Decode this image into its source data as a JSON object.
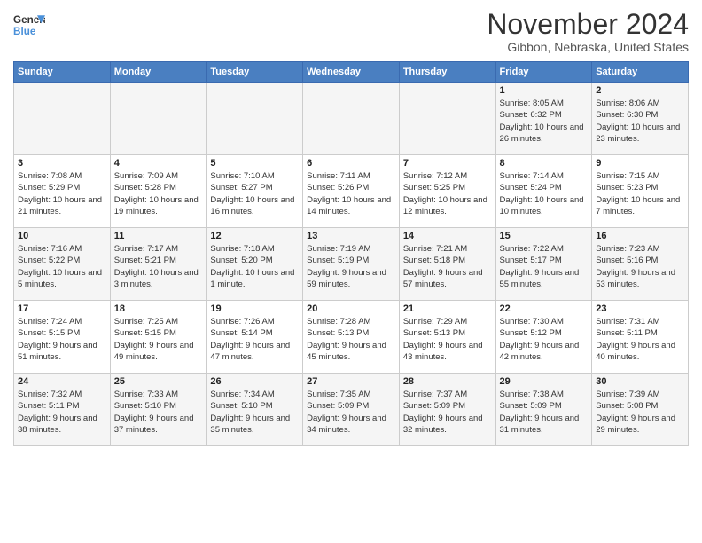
{
  "header": {
    "logo_line1": "General",
    "logo_line2": "Blue",
    "month": "November 2024",
    "location": "Gibbon, Nebraska, United States"
  },
  "weekdays": [
    "Sunday",
    "Monday",
    "Tuesday",
    "Wednesday",
    "Thursday",
    "Friday",
    "Saturday"
  ],
  "weeks": [
    [
      {
        "day": "",
        "info": ""
      },
      {
        "day": "",
        "info": ""
      },
      {
        "day": "",
        "info": ""
      },
      {
        "day": "",
        "info": ""
      },
      {
        "day": "",
        "info": ""
      },
      {
        "day": "1",
        "info": "Sunrise: 8:05 AM\nSunset: 6:32 PM\nDaylight: 10 hours and 26 minutes."
      },
      {
        "day": "2",
        "info": "Sunrise: 8:06 AM\nSunset: 6:30 PM\nDaylight: 10 hours and 23 minutes."
      }
    ],
    [
      {
        "day": "3",
        "info": "Sunrise: 7:08 AM\nSunset: 5:29 PM\nDaylight: 10 hours and 21 minutes."
      },
      {
        "day": "4",
        "info": "Sunrise: 7:09 AM\nSunset: 5:28 PM\nDaylight: 10 hours and 19 minutes."
      },
      {
        "day": "5",
        "info": "Sunrise: 7:10 AM\nSunset: 5:27 PM\nDaylight: 10 hours and 16 minutes."
      },
      {
        "day": "6",
        "info": "Sunrise: 7:11 AM\nSunset: 5:26 PM\nDaylight: 10 hours and 14 minutes."
      },
      {
        "day": "7",
        "info": "Sunrise: 7:12 AM\nSunset: 5:25 PM\nDaylight: 10 hours and 12 minutes."
      },
      {
        "day": "8",
        "info": "Sunrise: 7:14 AM\nSunset: 5:24 PM\nDaylight: 10 hours and 10 minutes."
      },
      {
        "day": "9",
        "info": "Sunrise: 7:15 AM\nSunset: 5:23 PM\nDaylight: 10 hours and 7 minutes."
      }
    ],
    [
      {
        "day": "10",
        "info": "Sunrise: 7:16 AM\nSunset: 5:22 PM\nDaylight: 10 hours and 5 minutes."
      },
      {
        "day": "11",
        "info": "Sunrise: 7:17 AM\nSunset: 5:21 PM\nDaylight: 10 hours and 3 minutes."
      },
      {
        "day": "12",
        "info": "Sunrise: 7:18 AM\nSunset: 5:20 PM\nDaylight: 10 hours and 1 minute."
      },
      {
        "day": "13",
        "info": "Sunrise: 7:19 AM\nSunset: 5:19 PM\nDaylight: 9 hours and 59 minutes."
      },
      {
        "day": "14",
        "info": "Sunrise: 7:21 AM\nSunset: 5:18 PM\nDaylight: 9 hours and 57 minutes."
      },
      {
        "day": "15",
        "info": "Sunrise: 7:22 AM\nSunset: 5:17 PM\nDaylight: 9 hours and 55 minutes."
      },
      {
        "day": "16",
        "info": "Sunrise: 7:23 AM\nSunset: 5:16 PM\nDaylight: 9 hours and 53 minutes."
      }
    ],
    [
      {
        "day": "17",
        "info": "Sunrise: 7:24 AM\nSunset: 5:15 PM\nDaylight: 9 hours and 51 minutes."
      },
      {
        "day": "18",
        "info": "Sunrise: 7:25 AM\nSunset: 5:15 PM\nDaylight: 9 hours and 49 minutes."
      },
      {
        "day": "19",
        "info": "Sunrise: 7:26 AM\nSunset: 5:14 PM\nDaylight: 9 hours and 47 minutes."
      },
      {
        "day": "20",
        "info": "Sunrise: 7:28 AM\nSunset: 5:13 PM\nDaylight: 9 hours and 45 minutes."
      },
      {
        "day": "21",
        "info": "Sunrise: 7:29 AM\nSunset: 5:13 PM\nDaylight: 9 hours and 43 minutes."
      },
      {
        "day": "22",
        "info": "Sunrise: 7:30 AM\nSunset: 5:12 PM\nDaylight: 9 hours and 42 minutes."
      },
      {
        "day": "23",
        "info": "Sunrise: 7:31 AM\nSunset: 5:11 PM\nDaylight: 9 hours and 40 minutes."
      }
    ],
    [
      {
        "day": "24",
        "info": "Sunrise: 7:32 AM\nSunset: 5:11 PM\nDaylight: 9 hours and 38 minutes."
      },
      {
        "day": "25",
        "info": "Sunrise: 7:33 AM\nSunset: 5:10 PM\nDaylight: 9 hours and 37 minutes."
      },
      {
        "day": "26",
        "info": "Sunrise: 7:34 AM\nSunset: 5:10 PM\nDaylight: 9 hours and 35 minutes."
      },
      {
        "day": "27",
        "info": "Sunrise: 7:35 AM\nSunset: 5:09 PM\nDaylight: 9 hours and 34 minutes."
      },
      {
        "day": "28",
        "info": "Sunrise: 7:37 AM\nSunset: 5:09 PM\nDaylight: 9 hours and 32 minutes."
      },
      {
        "day": "29",
        "info": "Sunrise: 7:38 AM\nSunset: 5:09 PM\nDaylight: 9 hours and 31 minutes."
      },
      {
        "day": "30",
        "info": "Sunrise: 7:39 AM\nSunset: 5:08 PM\nDaylight: 9 hours and 29 minutes."
      }
    ]
  ]
}
